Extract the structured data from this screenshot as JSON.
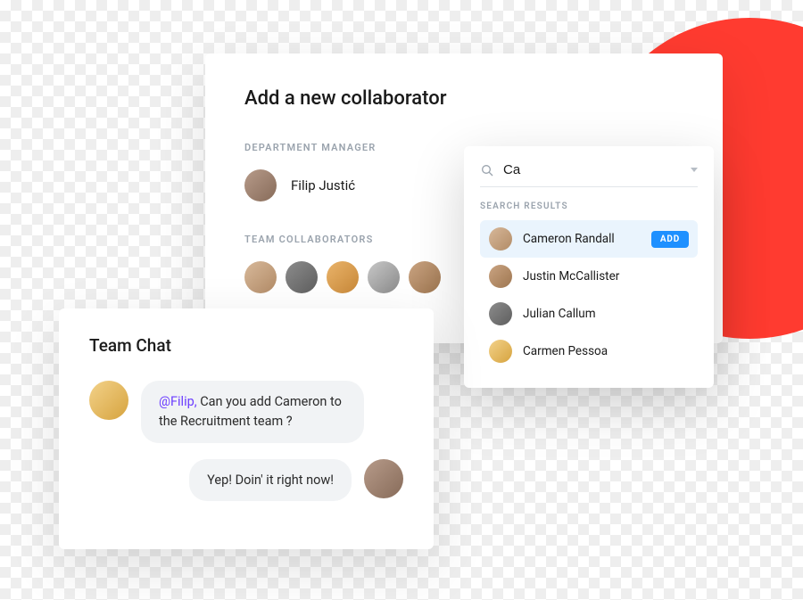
{
  "collaborator_panel": {
    "title": "Add a new collaborator",
    "manager_label": "Department Manager",
    "manager_name": "Filip Justić",
    "team_label": "Team Collaborators"
  },
  "search": {
    "value": "Ca",
    "results_label": "Search Results",
    "results": [
      {
        "name": "Cameron Randall",
        "add_label": "ADD",
        "highlight": true
      },
      {
        "name": "Justin McCallister"
      },
      {
        "name": "Julian Callum"
      },
      {
        "name": "Carmen Pessoa"
      }
    ]
  },
  "chat": {
    "title": "Team Chat",
    "messages": [
      {
        "mention": "@Filip,",
        "text": " Can you add Cameron to the Recruitment team ?"
      },
      {
        "text": "Yep! Doin' it right now!"
      }
    ]
  }
}
